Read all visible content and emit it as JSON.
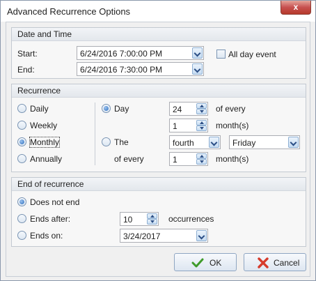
{
  "window": {
    "title": "Advanced Recurrence Options",
    "close_glyph": "x"
  },
  "date_time": {
    "header": "Date and Time",
    "start_label": "Start:",
    "start_value": "6/24/2016 7:00:00 PM",
    "end_label": "End:",
    "end_value": "6/24/2016 7:30:00 PM",
    "all_day_label": "All day event",
    "all_day_checked": false
  },
  "recurrence": {
    "header": "Recurrence",
    "patterns": [
      "Daily",
      "Weekly",
      "Monthly",
      "Annually"
    ],
    "selected_pattern": "Monthly",
    "day_option_label": "Day",
    "day_value": "24",
    "of_every_label": "of every",
    "month_interval_1": "1",
    "months_label_1": "month(s)",
    "the_option_label": "The",
    "ordinal_value": "fourth",
    "weekday_value": "Friday",
    "of_every_label_2": "of every",
    "month_interval_2": "1",
    "months_label_2": "month(s)"
  },
  "end_of_recurrence": {
    "header": "End of recurrence",
    "does_not_end_label": "Does not end",
    "ends_after_label": "Ends after:",
    "occurrences_value": "10",
    "occurrences_label": "occurrences",
    "ends_on_label": "Ends on:",
    "ends_on_value": "3/24/2017",
    "selected": "Does not end"
  },
  "buttons": {
    "ok_label": "OK",
    "cancel_label": "Cancel"
  },
  "colors": {
    "ok_check": "#3f9b2a",
    "cancel_x": "#d63b2b",
    "radio_fill": "#2e6fbf"
  }
}
